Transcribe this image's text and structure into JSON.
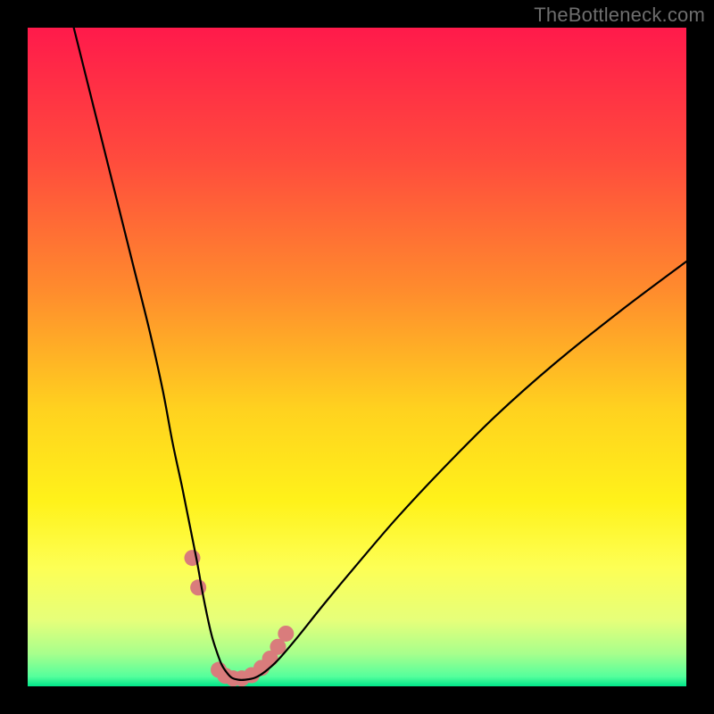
{
  "watermark": "TheBottleneck.com",
  "chart_data": {
    "type": "line",
    "title": "",
    "xlabel": "",
    "ylabel": "",
    "xlim": [
      0,
      100
    ],
    "ylim": [
      0,
      100
    ],
    "grid": false,
    "legend": false,
    "background_gradient": {
      "stops": [
        {
          "pos": 0.0,
          "color": "#ff1a4b"
        },
        {
          "pos": 0.2,
          "color": "#ff4b3d"
        },
        {
          "pos": 0.4,
          "color": "#ff8c2d"
        },
        {
          "pos": 0.58,
          "color": "#ffd21f"
        },
        {
          "pos": 0.72,
          "color": "#fff21a"
        },
        {
          "pos": 0.82,
          "color": "#fdff55"
        },
        {
          "pos": 0.9,
          "color": "#e6ff7a"
        },
        {
          "pos": 0.95,
          "color": "#a8ff8c"
        },
        {
          "pos": 0.985,
          "color": "#55ff9c"
        },
        {
          "pos": 1.0,
          "color": "#00e58a"
        }
      ]
    },
    "series": [
      {
        "name": "bottleneck-curve",
        "color": "#000000",
        "x": [
          7.0,
          10.0,
          13.0,
          16.0,
          18.5,
          20.5,
          22.0,
          23.5,
          24.7,
          25.7,
          26.5,
          27.3,
          28.0,
          28.8,
          29.5,
          30.3,
          31.0,
          32.0,
          33.0,
          34.5,
          36.0,
          38.0,
          41.0,
          45.0,
          50.0,
          56.0,
          63.0,
          71.0,
          80.0,
          90.0,
          100.0
        ],
        "y": [
          100.0,
          88.0,
          76.0,
          64.0,
          54.0,
          45.0,
          37.0,
          30.0,
          24.0,
          19.0,
          14.5,
          10.5,
          7.5,
          5.0,
          3.2,
          2.0,
          1.3,
          1.0,
          1.0,
          1.3,
          2.2,
          4.0,
          7.5,
          12.5,
          18.5,
          25.5,
          33.0,
          41.0,
          49.0,
          57.0,
          64.5
        ]
      }
    ],
    "markers": {
      "name": "highlight-dots",
      "color": "#d97c7c",
      "radius_px": 9,
      "points": [
        {
          "x": 25.0,
          "y": 19.5
        },
        {
          "x": 25.9,
          "y": 15.0
        },
        {
          "x": 29.0,
          "y": 2.5
        },
        {
          "x": 30.0,
          "y": 1.6
        },
        {
          "x": 31.2,
          "y": 1.2
        },
        {
          "x": 32.5,
          "y": 1.2
        },
        {
          "x": 34.0,
          "y": 1.7
        },
        {
          "x": 35.5,
          "y": 2.8
        },
        {
          "x": 36.8,
          "y": 4.2
        },
        {
          "x": 38.0,
          "y": 6.0
        },
        {
          "x": 39.2,
          "y": 8.0
        }
      ]
    }
  }
}
